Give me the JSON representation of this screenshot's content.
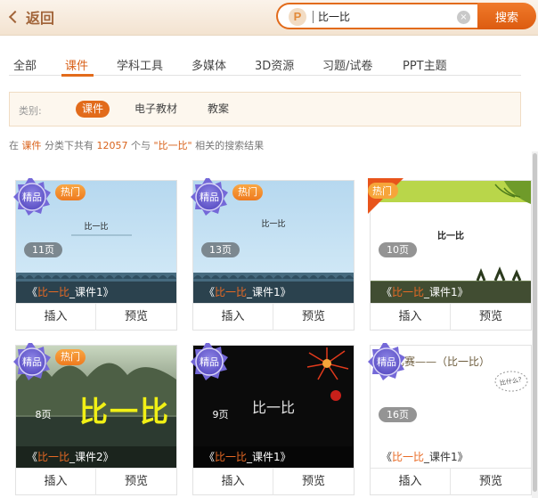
{
  "header": {
    "back_label": "返回",
    "search_value": "比一比",
    "search_button": "搜索",
    "logo_glyph": "P",
    "clear_glyph": "×"
  },
  "tabs": [
    {
      "label": "全部"
    },
    {
      "label": "课件"
    },
    {
      "label": "学科工具"
    },
    {
      "label": "多媒体"
    },
    {
      "label": "3D资源"
    },
    {
      "label": "习题/试卷"
    },
    {
      "label": "PPT主题"
    }
  ],
  "active_tab": "课件",
  "filter": {
    "label": "类别:",
    "options": [
      {
        "label": "课件"
      },
      {
        "label": "电子教材"
      },
      {
        "label": "教案"
      }
    ]
  },
  "result": {
    "prefix": "在",
    "category": "课件",
    "mid1": "分类下共有",
    "count": "12057",
    "mid2": "个与",
    "keyword": "\"比一比\"",
    "suffix": "相关的搜索结果"
  },
  "badges": {
    "premium": "精品",
    "hot": "热门"
  },
  "cards": [
    {
      "thumb_text": "比一比",
      "pages": "11页",
      "caption_open": "《",
      "caption_kw": "比一比",
      "caption_rest": "_课件1》",
      "insert": "插入",
      "preview": "预览"
    },
    {
      "thumb_text": "比一比",
      "pages": "13页",
      "caption_open": "《",
      "caption_kw": "比一比",
      "caption_rest": "_课件1》",
      "insert": "插入",
      "preview": "预览"
    },
    {
      "thumb_text": "比一比",
      "pages": "10页",
      "caption_open": "《",
      "caption_kw": "比一比",
      "caption_rest": "_课件1》",
      "insert": "插入",
      "preview": "预览"
    },
    {
      "thumb_text": "比一比",
      "pages": "8页",
      "caption_open": "《",
      "caption_kw": "比一比",
      "caption_rest": "_课件2》",
      "insert": "插入",
      "preview": "预览"
    },
    {
      "thumb_text": "比一比",
      "pages": "9页",
      "caption_open": "《",
      "caption_kw": "比一比",
      "caption_rest": "_课件1》",
      "insert": "插入",
      "preview": "预览"
    },
    {
      "thumb_text": "对比赛——（比一比）",
      "thumb_note": "比什么？",
      "pages": "16页",
      "caption_open": "《",
      "caption_kw": "比一比",
      "caption_rest": "_课件1》",
      "insert": "插入",
      "preview": "预览"
    }
  ],
  "colors": {
    "accent": "#e26b1b",
    "header_bg": "#f6e9da",
    "keyword": "#e96a24"
  }
}
